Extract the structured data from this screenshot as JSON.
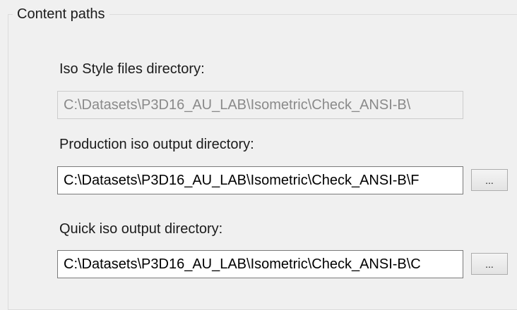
{
  "group": {
    "title": "Content paths"
  },
  "iso_style": {
    "label": "Iso Style files directory:",
    "value": "C:\\Datasets\\P3D16_AU_LAB\\Isometric\\Check_ANSI-B\\"
  },
  "production_output": {
    "label": "Production iso output directory:",
    "value": "C:\\Datasets\\P3D16_AU_LAB\\Isometric\\Check_ANSI-B\\F",
    "browse_label": "..."
  },
  "quick_output": {
    "label": "Quick iso output directory:",
    "value": "C:\\Datasets\\P3D16_AU_LAB\\Isometric\\Check_ANSI-B\\C",
    "browse_label": "..."
  }
}
